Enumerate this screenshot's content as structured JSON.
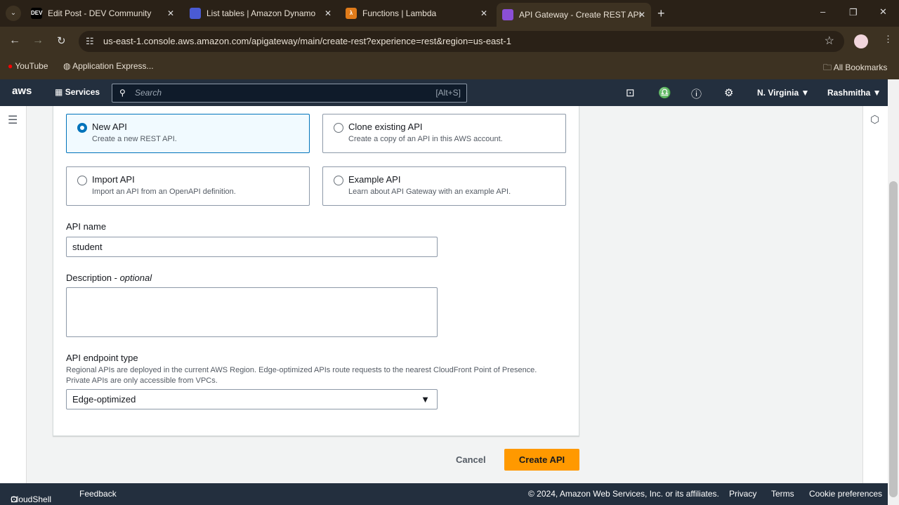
{
  "browser": {
    "tabs": [
      {
        "title": "Edit Post - DEV Community",
        "icon": "dev-icon"
      },
      {
        "title": "List tables | Amazon DynamoDB",
        "icon": "dynamodb-icon"
      },
      {
        "title": "Functions | Lambda",
        "icon": "lambda-icon"
      },
      {
        "title": "API Gateway - Create REST API",
        "icon": "api-gateway-icon",
        "active": true
      }
    ],
    "url": "us-east-1.console.aws.amazon.com/apigateway/main/create-rest?experience=rest&region=us-east-1",
    "bookmarks": [
      "YouTube",
      "Application Express..."
    ],
    "all_bookmarks": "All Bookmarks"
  },
  "aws_header": {
    "services": "Services",
    "search_placeholder": "Search",
    "search_shortcut": "[Alt+S]",
    "region": "N. Virginia ▼",
    "user": "Rashmitha ▼"
  },
  "form": {
    "options": [
      {
        "title": "New API",
        "desc": "Create a new REST API.",
        "selected": true
      },
      {
        "title": "Clone existing API",
        "desc": "Create a copy of an API in this AWS account.",
        "selected": false
      },
      {
        "title": "Import API",
        "desc": "Import an API from an OpenAPI definition.",
        "selected": false
      },
      {
        "title": "Example API",
        "desc": "Learn about API Gateway with an example API.",
        "selected": false
      }
    ],
    "api_name_label": "API name",
    "api_name_value": "student",
    "description_label": "Description - ",
    "description_optional": "optional",
    "description_value": "",
    "endpoint_label": "API endpoint type",
    "endpoint_hint": "Regional APIs are deployed in the current AWS Region. Edge-optimized APIs route requests to the nearest CloudFront Point of Presence. Private APIs are only accessible from VPCs.",
    "endpoint_value": "Edge-optimized"
  },
  "actions": {
    "cancel": "Cancel",
    "create": "Create API"
  },
  "colors": {
    "accent": "#0073bb",
    "primary_button": "#ff9900",
    "header": "#232f3e"
  },
  "footer": {
    "cloudshell": "CloudShell",
    "feedback": "Feedback",
    "copyright": "© 2024, Amazon Web Services, Inc. or its affiliates.",
    "privacy": "Privacy",
    "terms": "Terms",
    "cookies": "Cookie preferences"
  }
}
